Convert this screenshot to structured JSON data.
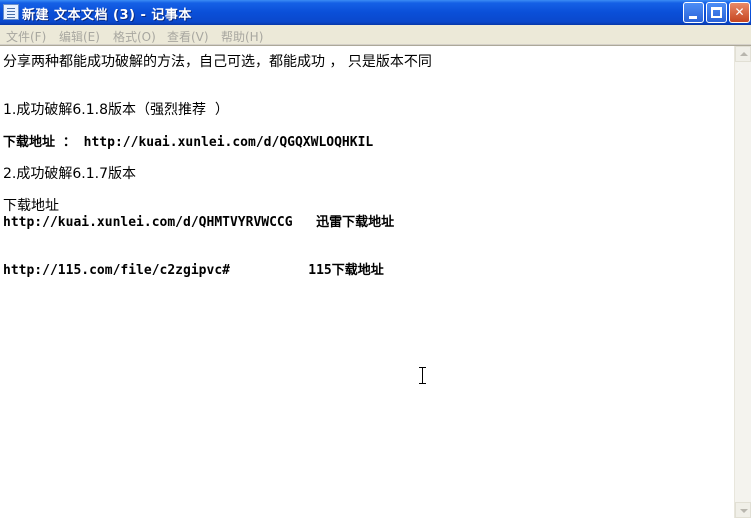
{
  "window": {
    "title": "新建 文本文档 (3) - 记事本",
    "app_icon": "notepad-icon",
    "controls": [
      "minimize-icon",
      "maximize-icon",
      "close-icon"
    ]
  },
  "menu": {
    "items": [
      {
        "label": "文件(F)"
      },
      {
        "label": "编辑(E)"
      },
      {
        "label": "格式(O)"
      },
      {
        "label": "查看(V)"
      },
      {
        "label": "帮助(H)"
      }
    ]
  },
  "document": {
    "lines": [
      "分享两种都能成功破解的方法，自己可选，都能成功 ， 只是版本不同",
      "1.成功破解6.1.8版本（强烈推荐  ）",
      "下载地址 ： http://kuai.xunlei.com/d/QGQXWLOQHKIL",
      "2.成功破解6.1.7版本",
      "下载地址",
      "http://kuai.xunlei.com/d/QHMTVYRVWCCG   迅雷下载地址",
      "http://115.com/file/c2zgipvc#          115下载地址"
    ]
  },
  "colors": {
    "titlebar": "#0a4fd8",
    "menubar": "#ece9d8",
    "menu_text_disabled": "#a8a7a0",
    "close_button": "#c64520"
  }
}
